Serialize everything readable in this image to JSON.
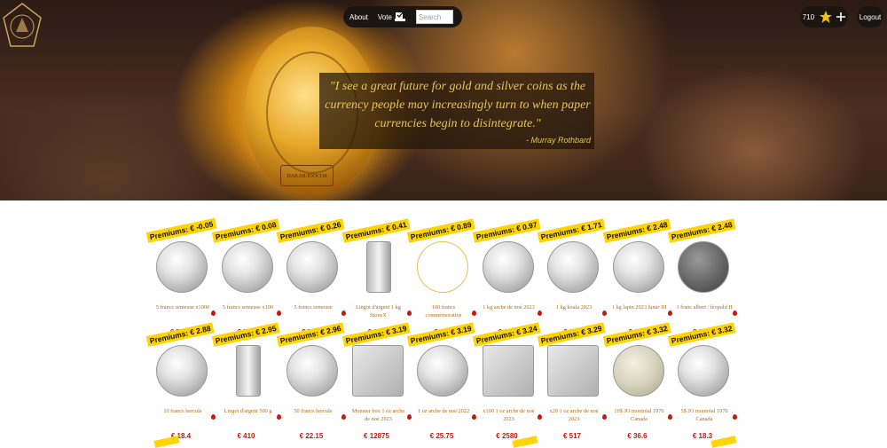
{
  "nav": {
    "about_label": "About",
    "vote_label": "Vote",
    "search_placeholder": "Search",
    "points": "710",
    "logout_label": "Logout"
  },
  "hero": {
    "quote": "\"I see a great future for gold and silver coins as the currency people may increasingly turn to when paper currencies begin to disintegrate.\"",
    "author": "- Murray Rothbard",
    "coin_plate": "DAKAR/IOOCOS"
  },
  "products": [
    {
      "premium": "Premiums: € -0.05",
      "name": "5 francs semeuse x1000",
      "price": "€ 7250",
      "style": "coin"
    },
    {
      "premium": "Premiums: € 0.08",
      "name": "5 francs semeuse x100",
      "price": "€ 729",
      "style": "coin"
    },
    {
      "premium": "Premiums: € 0.26",
      "name": "5 francs semeuse",
      "price": "€ 7.35",
      "style": "coin"
    },
    {
      "premium": "Premiums: € 0.41",
      "name": "Lingot d'argent 1 kg StoneX",
      "price": "€ 810",
      "style": "bar"
    },
    {
      "premium": "Premiums: € 0.89",
      "name": "100 francs commémorative",
      "price": "€ 9.8",
      "style": "ring"
    },
    {
      "premium": "Premiums: € 0.97",
      "name": "1 kg arche de noé 2023",
      "price": "€ 830",
      "style": "coin"
    },
    {
      "premium": "Premiums: € 1.71",
      "name": "1 kg koala 2023",
      "price": "€ 856",
      "style": "coin"
    },
    {
      "premium": "Premiums: € 2.48",
      "name": "1 kg lapin 2023 lunar III",
      "price": "€ 883",
      "style": "coin"
    },
    {
      "premium": "Premiums: € 2.48",
      "name": "1 franc albert / léopold II",
      "price": "€ 3.22",
      "style": "dark"
    },
    {
      "premium": "Premiums: € 2.88",
      "name": "10 francs hercule",
      "price": "€ 18.4",
      "style": "coin"
    },
    {
      "premium": "Premiums: € 2.95",
      "name": "Lingot d'argent 500 g",
      "price": "€ 410",
      "style": "bar"
    },
    {
      "premium": "Premiums: € 2.96",
      "name": "50 francs hercule",
      "price": "€ 22.15",
      "style": "coin"
    },
    {
      "premium": "Premiums: € 3.19",
      "name": "Monster box 1 oz arche de noé 2023",
      "price": "€ 12875",
      "style": "box"
    },
    {
      "premium": "Premiums: € 3.19",
      "name": "1 oz arche de noé 2022",
      "price": "€ 25.75",
      "style": "coin"
    },
    {
      "premium": "Premiums: € 3.24",
      "name": "x100 1 oz arche de noé 2023",
      "price": "€ 2580",
      "style": "box"
    },
    {
      "premium": "Premiums: € 3.29",
      "name": "x20 1 oz arche de noé 2023",
      "price": "€ 517",
      "style": "box"
    },
    {
      "premium": "Premiums: € 3.32",
      "name": "10$ JO montréal 1976 Canada",
      "price": "€ 36.6",
      "style": "palegold"
    },
    {
      "premium": "Premiums: € 3.32",
      "name": "5$ JO montréal 1976 Canada",
      "price": "€ 18.3",
      "style": "coin"
    }
  ]
}
